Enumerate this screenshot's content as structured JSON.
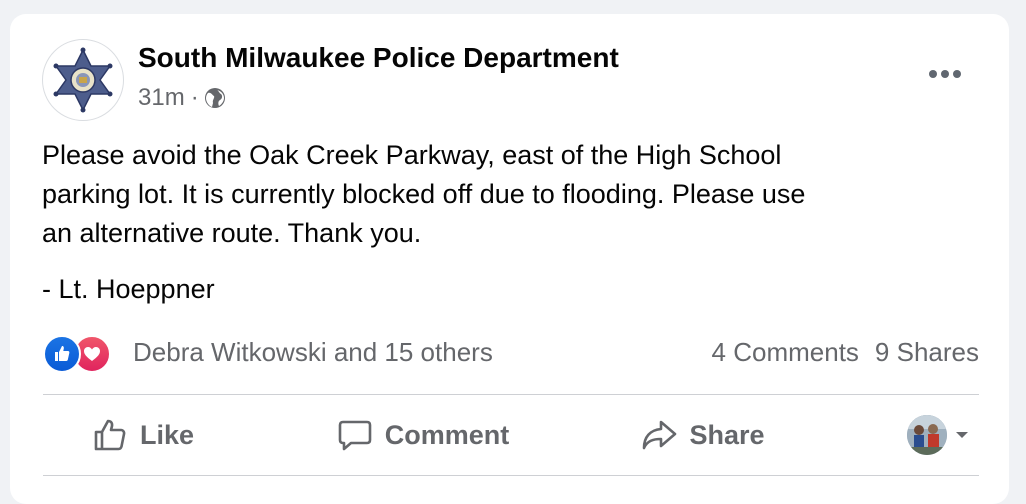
{
  "post": {
    "author": "South Milwaukee Police Department",
    "time": "31m",
    "separator": "·",
    "privacy_icon": "globe-icon",
    "more_icon": "more-horizontal-icon",
    "body": "Please avoid the Oak Creek Parkway, east of the High School\nparking lot.  It is currently blocked off due to flooding.  Please use\nan alternative route.  Thank you.",
    "signature": "- Lt. Hoeppner"
  },
  "reactions": {
    "icons": [
      "like-reaction-icon",
      "love-reaction-icon"
    ],
    "names": "Debra Witkowski and 15 others",
    "comments": "4 Comments",
    "shares": "9 Shares"
  },
  "actions": {
    "like": "Like",
    "comment": "Comment",
    "share": "Share"
  },
  "colors": {
    "page_bg": "#f0f2f5",
    "card_bg": "#ffffff",
    "secondary_text": "#65676b",
    "like_blue": "#1b74e4",
    "love_red": "#e0245e"
  }
}
